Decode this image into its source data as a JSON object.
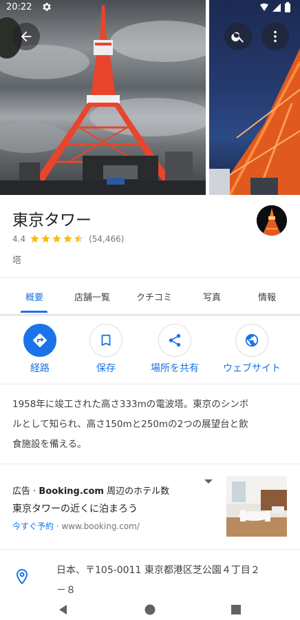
{
  "status_bar": {
    "time": "20:22"
  },
  "place": {
    "name": "東京タワー",
    "rating": "4.4",
    "stars": 4.4,
    "review_count": "(54,466)",
    "category": "塔"
  },
  "tabs": [
    {
      "label": "概要",
      "active": true
    },
    {
      "label": "店舗一覧",
      "active": false
    },
    {
      "label": "クチコミ",
      "active": false
    },
    {
      "label": "写真",
      "active": false
    },
    {
      "label": "情報",
      "active": false
    }
  ],
  "actions": [
    {
      "label": "経路",
      "icon": "directions-icon"
    },
    {
      "label": "保存",
      "icon": "bookmark-icon"
    },
    {
      "label": "場所を共有",
      "icon": "share-icon"
    },
    {
      "label": "ウェブサイト",
      "icon": "globe-icon"
    }
  ],
  "description": {
    "line1": "1958年に竣工された高さ333mの電波塔。東京のシンボ",
    "line2": "ルとして知られ、高さ150mと250mの2つの展望台と飲",
    "line3": "食施設を備える。"
  },
  "ad": {
    "badge": "広告 · ",
    "advertiser": "Booking.com",
    "headline_suffix": " 周辺のホテル数",
    "subtitle": "東京タワーの近くに泊まろう",
    "cta": "今すぐ予約",
    "separator": " · ",
    "url": "www.booking.com/"
  },
  "address": {
    "line1": "日本、〒105-0011 東京都港区芝公園４丁目２",
    "line2": "－８"
  },
  "colors": {
    "accent": "#1a73e8",
    "star": "#fbbc04",
    "tower": "#e8452c"
  }
}
